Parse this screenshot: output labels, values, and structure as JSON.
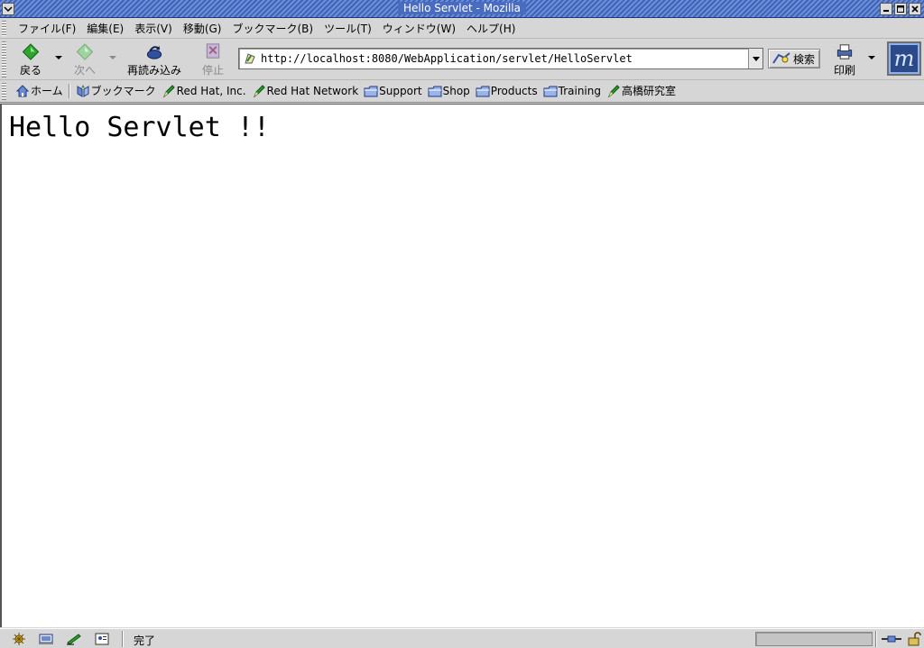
{
  "window": {
    "title": "Hello Servlet - Mozilla"
  },
  "menu": {
    "items": [
      {
        "label": "ファイル(F)"
      },
      {
        "label": "編集(E)"
      },
      {
        "label": "表示(V)"
      },
      {
        "label": "移動(G)"
      },
      {
        "label": "ブックマーク(B)"
      },
      {
        "label": "ツール(T)"
      },
      {
        "label": "ウィンドウ(W)"
      },
      {
        "label": "ヘルプ(H)"
      }
    ]
  },
  "nav": {
    "back_label": "戻る",
    "forward_label": "次へ",
    "reload_label": "再読み込み",
    "stop_label": "停止",
    "search_label": "検索",
    "print_label": "印刷",
    "url": "http://localhost:8080/WebApplication/servlet/HelloServlet"
  },
  "personal_toolbar": {
    "home_label": "ホーム",
    "bookmarks_label": "ブックマーク",
    "links": [
      {
        "label": "Red Hat, Inc.",
        "icon": "bookmark-pen-icon"
      },
      {
        "label": "Red Hat Network",
        "icon": "bookmark-pen-icon"
      },
      {
        "label": "Support",
        "icon": "folder-icon"
      },
      {
        "label": "Shop",
        "icon": "folder-icon"
      },
      {
        "label": "Products",
        "icon": "folder-icon"
      },
      {
        "label": "Training",
        "icon": "folder-icon"
      },
      {
        "label": "高橋研究室",
        "icon": "bookmark-pen-icon"
      }
    ]
  },
  "page": {
    "heading": "Hello Servlet !!"
  },
  "status": {
    "text": "完了",
    "progress": 0
  },
  "colors": {
    "titlebar": "#4a6cc0",
    "chrome": "#d6d6d6",
    "content_bg": "#ffffff"
  }
}
